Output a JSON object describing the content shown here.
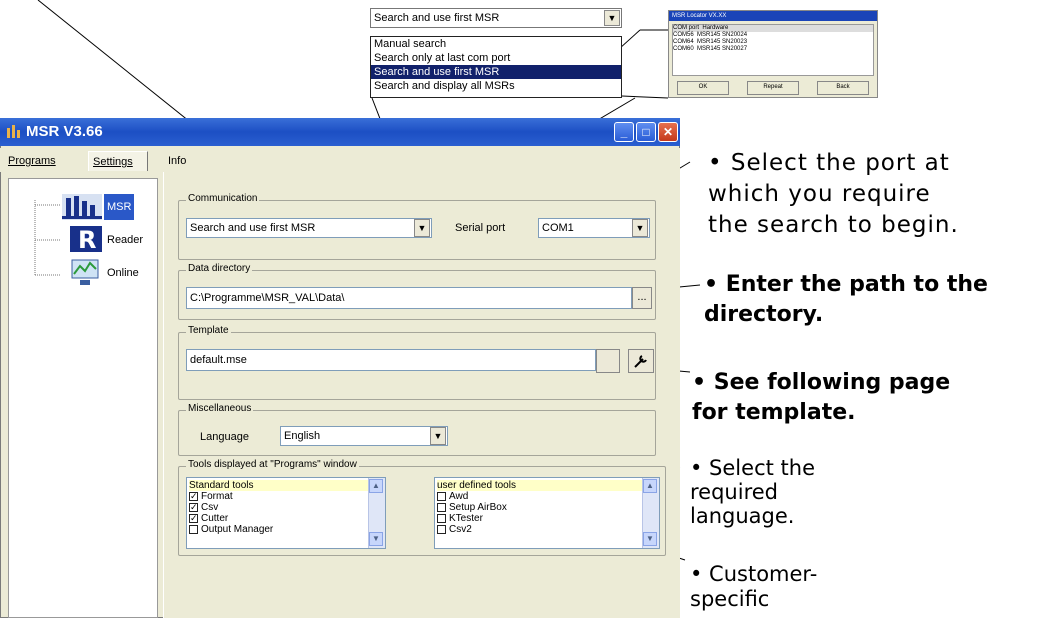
{
  "window": {
    "title": "MSR V3.66",
    "controls": {
      "minimize": "_",
      "maximize": "□",
      "close": "✕"
    }
  },
  "tabs": [
    "Programs",
    "Settings",
    "Info"
  ],
  "sidebar": {
    "items": [
      {
        "label": "MSR",
        "icon": "msr-icon"
      },
      {
        "label": "Reader",
        "icon": "reader-icon"
      },
      {
        "label": "Online",
        "icon": "online-icon"
      }
    ]
  },
  "communication": {
    "group": "Communication",
    "search_mode": "Search and use first MSR",
    "serial_port_label": "Serial port",
    "serial_port": "COM1"
  },
  "data_directory": {
    "group": "Data directory",
    "path": "C:\\Programme\\MSR_VAL\\Data\\",
    "browse": "..."
  },
  "template": {
    "group": "Template",
    "file": "default.mse",
    "edit_icon": "wrench-icon"
  },
  "misc": {
    "group": "Miscellaneous",
    "language_label": "Language",
    "language": "English"
  },
  "tools": {
    "group": "Tools displayed at \"Programs\" window",
    "standard": {
      "header": "Standard tools",
      "items": [
        {
          "label": "Format",
          "checked": true
        },
        {
          "label": "Csv",
          "checked": true
        },
        {
          "label": "Cutter",
          "checked": true
        },
        {
          "label": "Output Manager",
          "checked": false
        }
      ]
    },
    "user": {
      "header": "user defined tools",
      "items": [
        {
          "label": "Awd",
          "checked": false
        },
        {
          "label": "Setup AirBox",
          "checked": false
        },
        {
          "label": "KTester",
          "checked": false
        },
        {
          "label": "Csv2",
          "checked": false
        }
      ]
    }
  },
  "search_dropdown": {
    "current": "Search and use first MSR",
    "options": [
      "Manual search",
      "Search only at last com port",
      "Search and use first MSR",
      "Search and display all MSRs"
    ],
    "selected_index": 2
  },
  "msr_locator": {
    "title": "MSR Locator VX.XX",
    "columns": [
      "COM port",
      "Hardware"
    ],
    "rows": [
      [
        "COM56",
        "MSR145 SN20024"
      ],
      [
        "COM64",
        "MSR145 SN20023"
      ],
      [
        "COM60",
        "MSR145 SN20027"
      ]
    ],
    "buttons": [
      "OK",
      "Repeat",
      "Back"
    ]
  },
  "annotations": {
    "port": [
      "• Select the port at",
      "which you require",
      "the search to begin."
    ],
    "directory": [
      "• Enter the path to the",
      "directory."
    ],
    "template": [
      "• See following page",
      "for template."
    ],
    "language": [
      "• Select the",
      "required",
      "language."
    ],
    "customer": [
      "• Customer-",
      "specific"
    ]
  }
}
